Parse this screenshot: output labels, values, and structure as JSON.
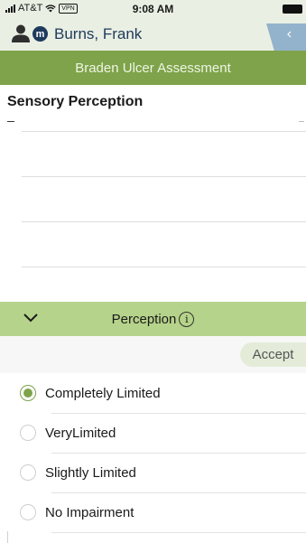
{
  "status_bar": {
    "carrier": "AT&T",
    "vpn": "VPN",
    "time": "9:08 AM"
  },
  "header": {
    "patient_name": "Burns, Frank",
    "badge": "m",
    "icons": [
      "person-icon",
      "m-badge-icon",
      "back-chevron-icon"
    ]
  },
  "title_bar": {
    "title": "Braden Ulcer Assessment"
  },
  "section": {
    "title": "Sensory Perception"
  },
  "perception_bar": {
    "label": "Perception",
    "info": "i"
  },
  "accept": {
    "label": "Accept"
  },
  "options": [
    {
      "label": "Completely Limited",
      "selected": true
    },
    {
      "label": "VeryLimited",
      "selected": false
    },
    {
      "label": "Slightly Limited",
      "selected": false
    },
    {
      "label": "No Impairment",
      "selected": false
    }
  ],
  "colors": {
    "accent": "#7fa34a",
    "accent_light": "#b5d38a",
    "header_bg": "#e9efe3",
    "name_color": "#1e3a5c"
  }
}
